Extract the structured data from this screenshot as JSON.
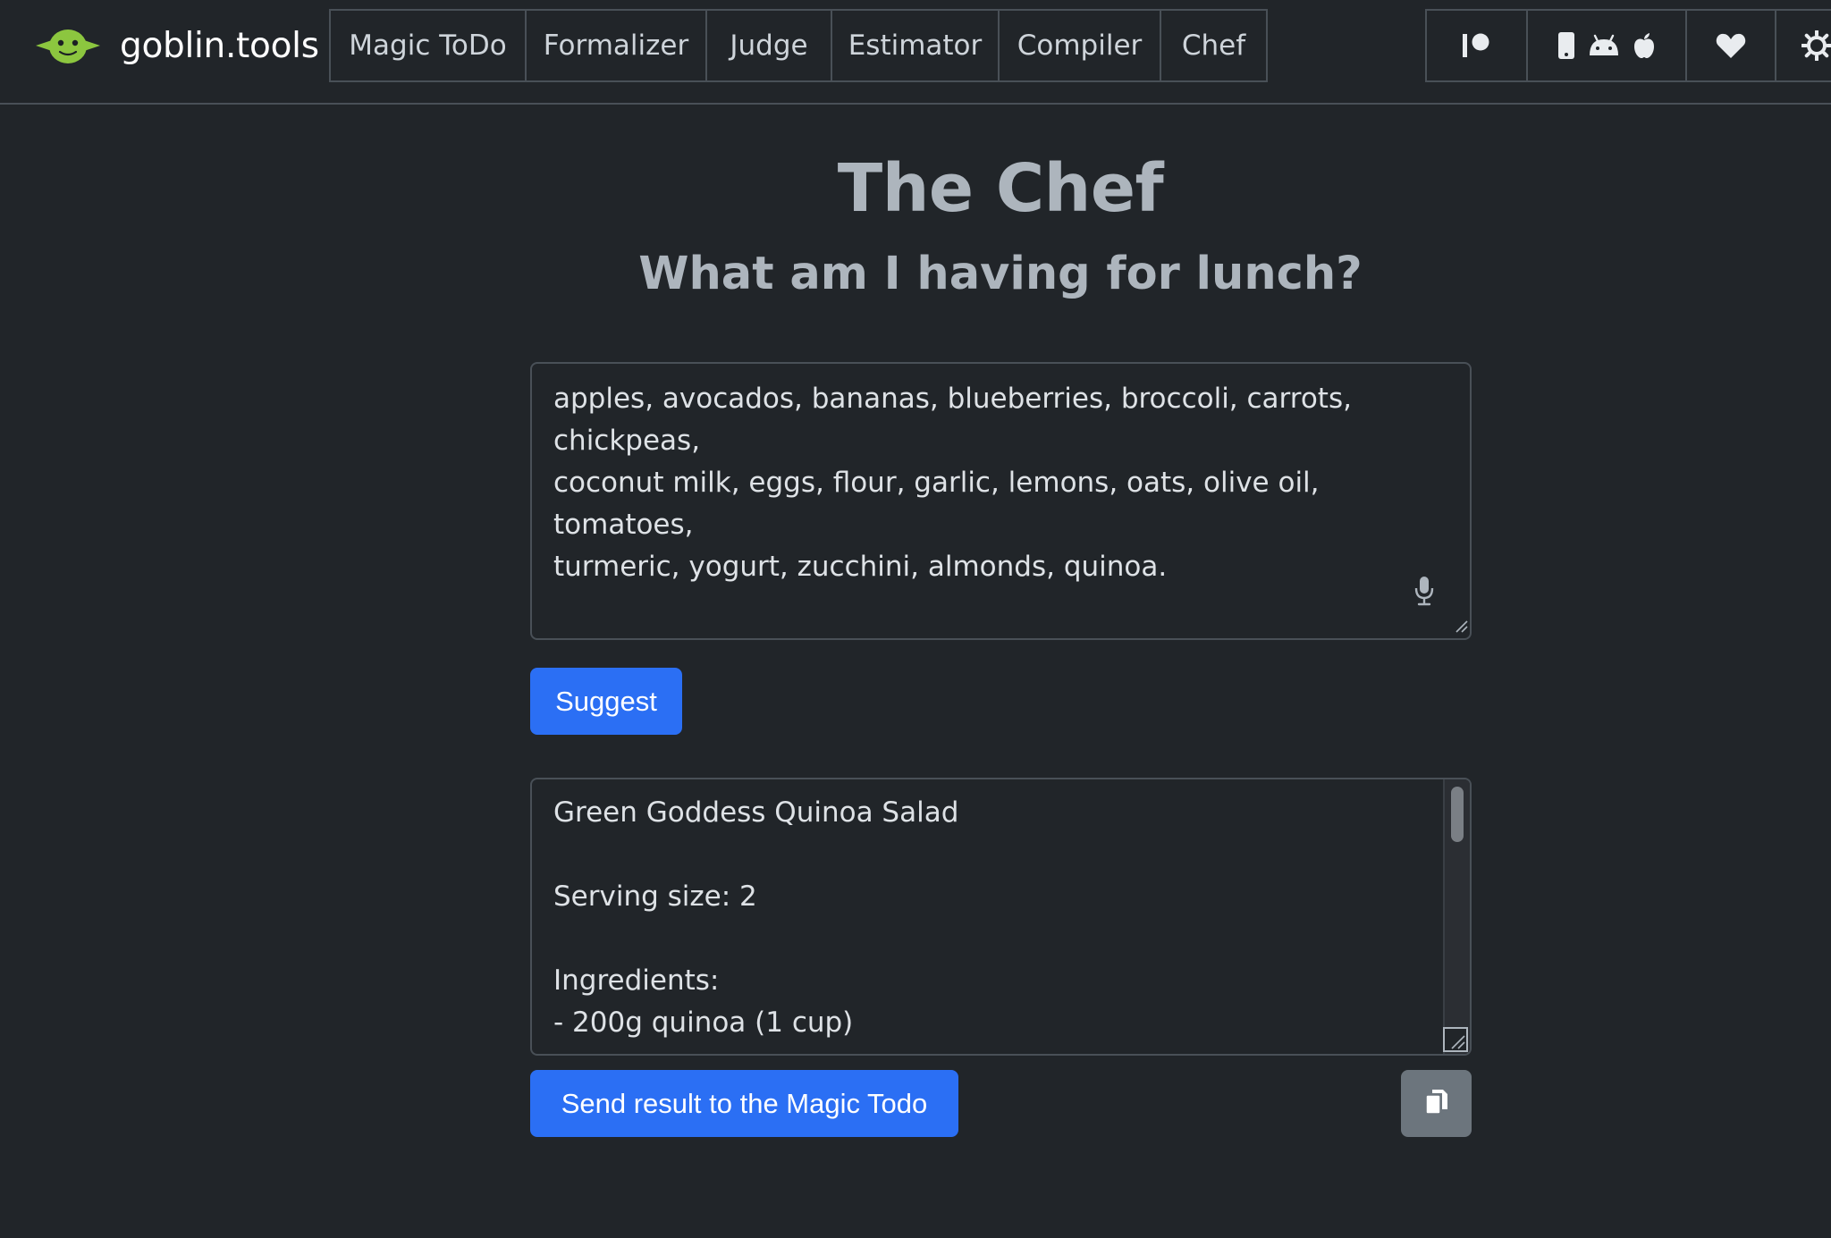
{
  "brand": {
    "name": "goblin.tools",
    "logo_icon": "goblin-head-icon",
    "logo_color": "#8cc63f"
  },
  "nav": {
    "tabs": [
      {
        "label": "Magic ToDo"
      },
      {
        "label": "Formalizer"
      },
      {
        "label": "Judge"
      },
      {
        "label": "Estimator"
      },
      {
        "label": "Compiler"
      },
      {
        "label": "Chef"
      }
    ],
    "icons": [
      "patreon-icon",
      "phone-icon",
      "android-icon",
      "apple-icon",
      "heart-icon",
      "settings-icon"
    ]
  },
  "main": {
    "title": "The Chef",
    "subtitle": "What am I having for lunch?",
    "input_text": "apples, avocados, bananas, blueberries, broccoli, carrots, chickpeas,\ncoconut milk, eggs, flour, garlic, lemons, oats, olive oil, tomatoes,\nturmeric, yogurt, zucchini, almonds, quinoa.",
    "suggest_label": "Suggest",
    "result_lines": [
      "Green Goddess Quinoa Salad",
      "",
      "Serving size: 2",
      "",
      "Ingredients:",
      "- 200g quinoa (1 cup)"
    ],
    "send_label": "Send result to the Magic Todo"
  },
  "colors": {
    "background": "#212529",
    "primary": "#2b6ff4",
    "secondary": "#6c757d",
    "border": "#495057"
  }
}
